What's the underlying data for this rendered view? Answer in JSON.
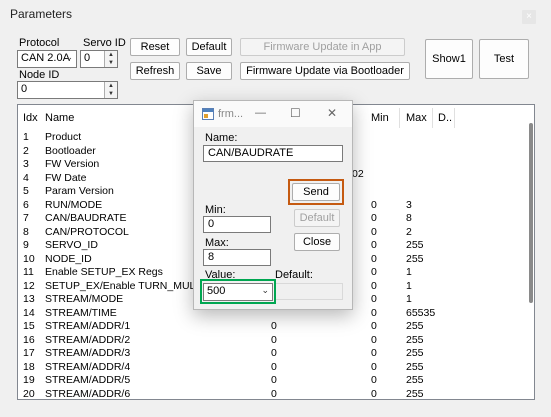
{
  "window": {
    "title": "Parameters",
    "close_glyph": "×"
  },
  "protocol": {
    "label": "Protocol",
    "value": "CAN 2.0A"
  },
  "servo_id": {
    "label": "Servo ID",
    "value": "0"
  },
  "node_id": {
    "label": "Node ID",
    "value": "0"
  },
  "buttons": {
    "reset": "Reset",
    "default": "Default",
    "firmware_app": "Firmware Update in App",
    "refresh": "Refresh",
    "save": "Save",
    "firmware_bootloader": "Firmware Update via Bootloader",
    "show1": "Show1",
    "test": "Test"
  },
  "table": {
    "columns": [
      "Idx",
      "Name",
      "Min",
      "Max",
      "D.."
    ],
    "visible_fragment": "02",
    "rows": [
      {
        "idx": "1",
        "name": "Product",
        "val": "",
        "min": "",
        "max": ""
      },
      {
        "idx": "2",
        "name": "Bootloader",
        "val": "",
        "min": "",
        "max": ""
      },
      {
        "idx": "3",
        "name": "FW Version",
        "val": "",
        "min": "",
        "max": ""
      },
      {
        "idx": "4",
        "name": "FW Date",
        "val": "",
        "min": "",
        "max": ""
      },
      {
        "idx": "5",
        "name": "Param Version",
        "val": "",
        "min": "",
        "max": ""
      },
      {
        "idx": "6",
        "name": "RUN/MODE",
        "val": "",
        "min": "0",
        "max": "3"
      },
      {
        "idx": "7",
        "name": "CAN/BAUDRATE",
        "val": "",
        "min": "0",
        "max": "8"
      },
      {
        "idx": "8",
        "name": "CAN/PROTOCOL",
        "val": "",
        "min": "0",
        "max": "2"
      },
      {
        "idx": "9",
        "name": "SERVO_ID",
        "val": "",
        "min": "0",
        "max": "255"
      },
      {
        "idx": "10",
        "name": "NODE_ID",
        "val": "",
        "min": "0",
        "max": "255"
      },
      {
        "idx": "11",
        "name": "Enable SETUP_EX Regs",
        "val": "",
        "min": "0",
        "max": "1"
      },
      {
        "idx": "12",
        "name": "SETUP_EX/Enable TURN_MULTIPLIE",
        "val": "",
        "min": "0",
        "max": "1"
      },
      {
        "idx": "13",
        "name": "STREAM/MODE",
        "val": "",
        "min": "0",
        "max": "1"
      },
      {
        "idx": "14",
        "name": "STREAM/TIME",
        "val": "",
        "min": "0",
        "max": "65535"
      },
      {
        "idx": "15",
        "name": "STREAM/ADDR/1",
        "val": "0",
        "min": "0",
        "max": "255"
      },
      {
        "idx": "16",
        "name": "STREAM/ADDR/2",
        "val": "0",
        "min": "0",
        "max": "255"
      },
      {
        "idx": "17",
        "name": "STREAM/ADDR/3",
        "val": "0",
        "min": "0",
        "max": "255"
      },
      {
        "idx": "18",
        "name": "STREAM/ADDR/4",
        "val": "0",
        "min": "0",
        "max": "255"
      },
      {
        "idx": "19",
        "name": "STREAM/ADDR/5",
        "val": "0",
        "min": "0",
        "max": "255"
      },
      {
        "idx": "20",
        "name": "STREAM/ADDR/6",
        "val": "0",
        "min": "0",
        "max": "255"
      }
    ]
  },
  "dialog": {
    "title": "frm...",
    "minimize_glyph": "—",
    "maximize_glyph": "☐",
    "close_glyph": "✕",
    "name_label": "Name:",
    "name_value": "CAN/BAUDRATE",
    "send": "Send",
    "min_label": "Min:",
    "min_value": "0",
    "default_btn": "Default",
    "max_label": "Max:",
    "max_value": "8",
    "close_btn": "Close",
    "value_label": "Value:",
    "value_selected": "500",
    "default_label": "Default:"
  },
  "colors": {
    "send_highlight": "#c55a11",
    "value_highlight": "#00a651"
  }
}
